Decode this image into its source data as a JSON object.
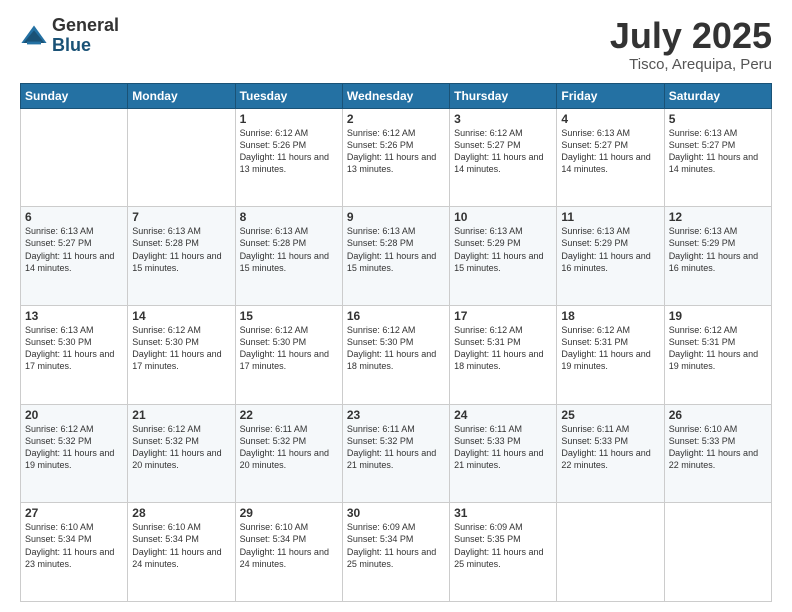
{
  "logo": {
    "general": "General",
    "blue": "Blue"
  },
  "title": {
    "month": "July 2025",
    "location": "Tisco, Arequipa, Peru"
  },
  "days_of_week": [
    "Sunday",
    "Monday",
    "Tuesday",
    "Wednesday",
    "Thursday",
    "Friday",
    "Saturday"
  ],
  "weeks": [
    [
      {
        "day": "",
        "sunrise": "",
        "sunset": "",
        "daylight": ""
      },
      {
        "day": "",
        "sunrise": "",
        "sunset": "",
        "daylight": ""
      },
      {
        "day": "1",
        "sunrise": "Sunrise: 6:12 AM",
        "sunset": "Sunset: 5:26 PM",
        "daylight": "Daylight: 11 hours and 13 minutes."
      },
      {
        "day": "2",
        "sunrise": "Sunrise: 6:12 AM",
        "sunset": "Sunset: 5:26 PM",
        "daylight": "Daylight: 11 hours and 13 minutes."
      },
      {
        "day": "3",
        "sunrise": "Sunrise: 6:12 AM",
        "sunset": "Sunset: 5:27 PM",
        "daylight": "Daylight: 11 hours and 14 minutes."
      },
      {
        "day": "4",
        "sunrise": "Sunrise: 6:13 AM",
        "sunset": "Sunset: 5:27 PM",
        "daylight": "Daylight: 11 hours and 14 minutes."
      },
      {
        "day": "5",
        "sunrise": "Sunrise: 6:13 AM",
        "sunset": "Sunset: 5:27 PM",
        "daylight": "Daylight: 11 hours and 14 minutes."
      }
    ],
    [
      {
        "day": "6",
        "sunrise": "Sunrise: 6:13 AM",
        "sunset": "Sunset: 5:27 PM",
        "daylight": "Daylight: 11 hours and 14 minutes."
      },
      {
        "day": "7",
        "sunrise": "Sunrise: 6:13 AM",
        "sunset": "Sunset: 5:28 PM",
        "daylight": "Daylight: 11 hours and 15 minutes."
      },
      {
        "day": "8",
        "sunrise": "Sunrise: 6:13 AM",
        "sunset": "Sunset: 5:28 PM",
        "daylight": "Daylight: 11 hours and 15 minutes."
      },
      {
        "day": "9",
        "sunrise": "Sunrise: 6:13 AM",
        "sunset": "Sunset: 5:28 PM",
        "daylight": "Daylight: 11 hours and 15 minutes."
      },
      {
        "day": "10",
        "sunrise": "Sunrise: 6:13 AM",
        "sunset": "Sunset: 5:29 PM",
        "daylight": "Daylight: 11 hours and 15 minutes."
      },
      {
        "day": "11",
        "sunrise": "Sunrise: 6:13 AM",
        "sunset": "Sunset: 5:29 PM",
        "daylight": "Daylight: 11 hours and 16 minutes."
      },
      {
        "day": "12",
        "sunrise": "Sunrise: 6:13 AM",
        "sunset": "Sunset: 5:29 PM",
        "daylight": "Daylight: 11 hours and 16 minutes."
      }
    ],
    [
      {
        "day": "13",
        "sunrise": "Sunrise: 6:13 AM",
        "sunset": "Sunset: 5:30 PM",
        "daylight": "Daylight: 11 hours and 17 minutes."
      },
      {
        "day": "14",
        "sunrise": "Sunrise: 6:12 AM",
        "sunset": "Sunset: 5:30 PM",
        "daylight": "Daylight: 11 hours and 17 minutes."
      },
      {
        "day": "15",
        "sunrise": "Sunrise: 6:12 AM",
        "sunset": "Sunset: 5:30 PM",
        "daylight": "Daylight: 11 hours and 17 minutes."
      },
      {
        "day": "16",
        "sunrise": "Sunrise: 6:12 AM",
        "sunset": "Sunset: 5:30 PM",
        "daylight": "Daylight: 11 hours and 18 minutes."
      },
      {
        "day": "17",
        "sunrise": "Sunrise: 6:12 AM",
        "sunset": "Sunset: 5:31 PM",
        "daylight": "Daylight: 11 hours and 18 minutes."
      },
      {
        "day": "18",
        "sunrise": "Sunrise: 6:12 AM",
        "sunset": "Sunset: 5:31 PM",
        "daylight": "Daylight: 11 hours and 19 minutes."
      },
      {
        "day": "19",
        "sunrise": "Sunrise: 6:12 AM",
        "sunset": "Sunset: 5:31 PM",
        "daylight": "Daylight: 11 hours and 19 minutes."
      }
    ],
    [
      {
        "day": "20",
        "sunrise": "Sunrise: 6:12 AM",
        "sunset": "Sunset: 5:32 PM",
        "daylight": "Daylight: 11 hours and 19 minutes."
      },
      {
        "day": "21",
        "sunrise": "Sunrise: 6:12 AM",
        "sunset": "Sunset: 5:32 PM",
        "daylight": "Daylight: 11 hours and 20 minutes."
      },
      {
        "day": "22",
        "sunrise": "Sunrise: 6:11 AM",
        "sunset": "Sunset: 5:32 PM",
        "daylight": "Daylight: 11 hours and 20 minutes."
      },
      {
        "day": "23",
        "sunrise": "Sunrise: 6:11 AM",
        "sunset": "Sunset: 5:32 PM",
        "daylight": "Daylight: 11 hours and 21 minutes."
      },
      {
        "day": "24",
        "sunrise": "Sunrise: 6:11 AM",
        "sunset": "Sunset: 5:33 PM",
        "daylight": "Daylight: 11 hours and 21 minutes."
      },
      {
        "day": "25",
        "sunrise": "Sunrise: 6:11 AM",
        "sunset": "Sunset: 5:33 PM",
        "daylight": "Daylight: 11 hours and 22 minutes."
      },
      {
        "day": "26",
        "sunrise": "Sunrise: 6:10 AM",
        "sunset": "Sunset: 5:33 PM",
        "daylight": "Daylight: 11 hours and 22 minutes."
      }
    ],
    [
      {
        "day": "27",
        "sunrise": "Sunrise: 6:10 AM",
        "sunset": "Sunset: 5:34 PM",
        "daylight": "Daylight: 11 hours and 23 minutes."
      },
      {
        "day": "28",
        "sunrise": "Sunrise: 6:10 AM",
        "sunset": "Sunset: 5:34 PM",
        "daylight": "Daylight: 11 hours and 24 minutes."
      },
      {
        "day": "29",
        "sunrise": "Sunrise: 6:10 AM",
        "sunset": "Sunset: 5:34 PM",
        "daylight": "Daylight: 11 hours and 24 minutes."
      },
      {
        "day": "30",
        "sunrise": "Sunrise: 6:09 AM",
        "sunset": "Sunset: 5:34 PM",
        "daylight": "Daylight: 11 hours and 25 minutes."
      },
      {
        "day": "31",
        "sunrise": "Sunrise: 6:09 AM",
        "sunset": "Sunset: 5:35 PM",
        "daylight": "Daylight: 11 hours and 25 minutes."
      },
      {
        "day": "",
        "sunrise": "",
        "sunset": "",
        "daylight": ""
      },
      {
        "day": "",
        "sunrise": "",
        "sunset": "",
        "daylight": ""
      }
    ]
  ]
}
